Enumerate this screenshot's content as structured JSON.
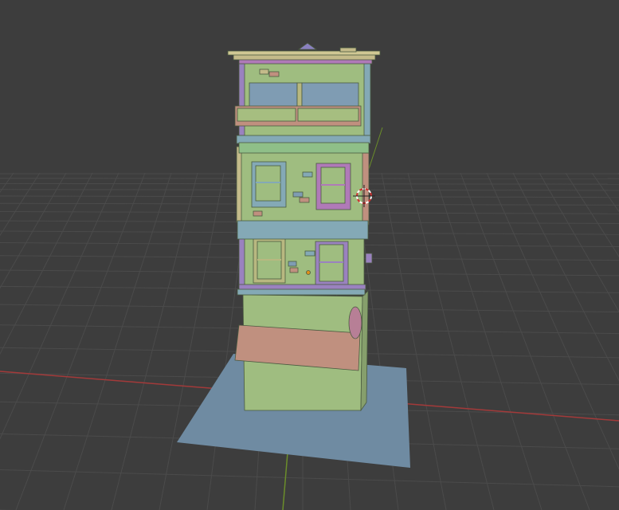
{
  "viewport": {
    "mode": "3D viewport",
    "colors": {
      "background": "#3d3d3d",
      "grid": "#4a4a4a",
      "x_axis": "#a33a3a",
      "y_axis": "#6b8e2a",
      "ground": "#6f8ba2",
      "wall": "#9fbd80",
      "trim_purple": "#9a82bf",
      "trim_blue": "#84a9b6",
      "trim_pink": "#c0907f",
      "trim_tan": "#c4bb8a",
      "glass": "#7f9cb3"
    },
    "objects": [
      "building",
      "ground-plane",
      "3d-cursor"
    ]
  }
}
